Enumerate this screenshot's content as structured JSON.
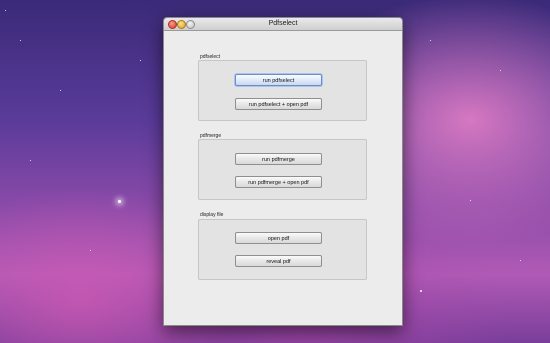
{
  "window": {
    "title": "Pdfselect"
  },
  "sections": [
    {
      "label": "pdfselect",
      "buttons": [
        "run pdfselect",
        "run pdfselect + open pdf"
      ]
    },
    {
      "label": "pdfmerge",
      "buttons": [
        "run pdfmerge",
        "run pdfmerge + open pdf"
      ]
    },
    {
      "label": "display file",
      "buttons": [
        "open pdf",
        "reveal pdf"
      ]
    }
  ]
}
